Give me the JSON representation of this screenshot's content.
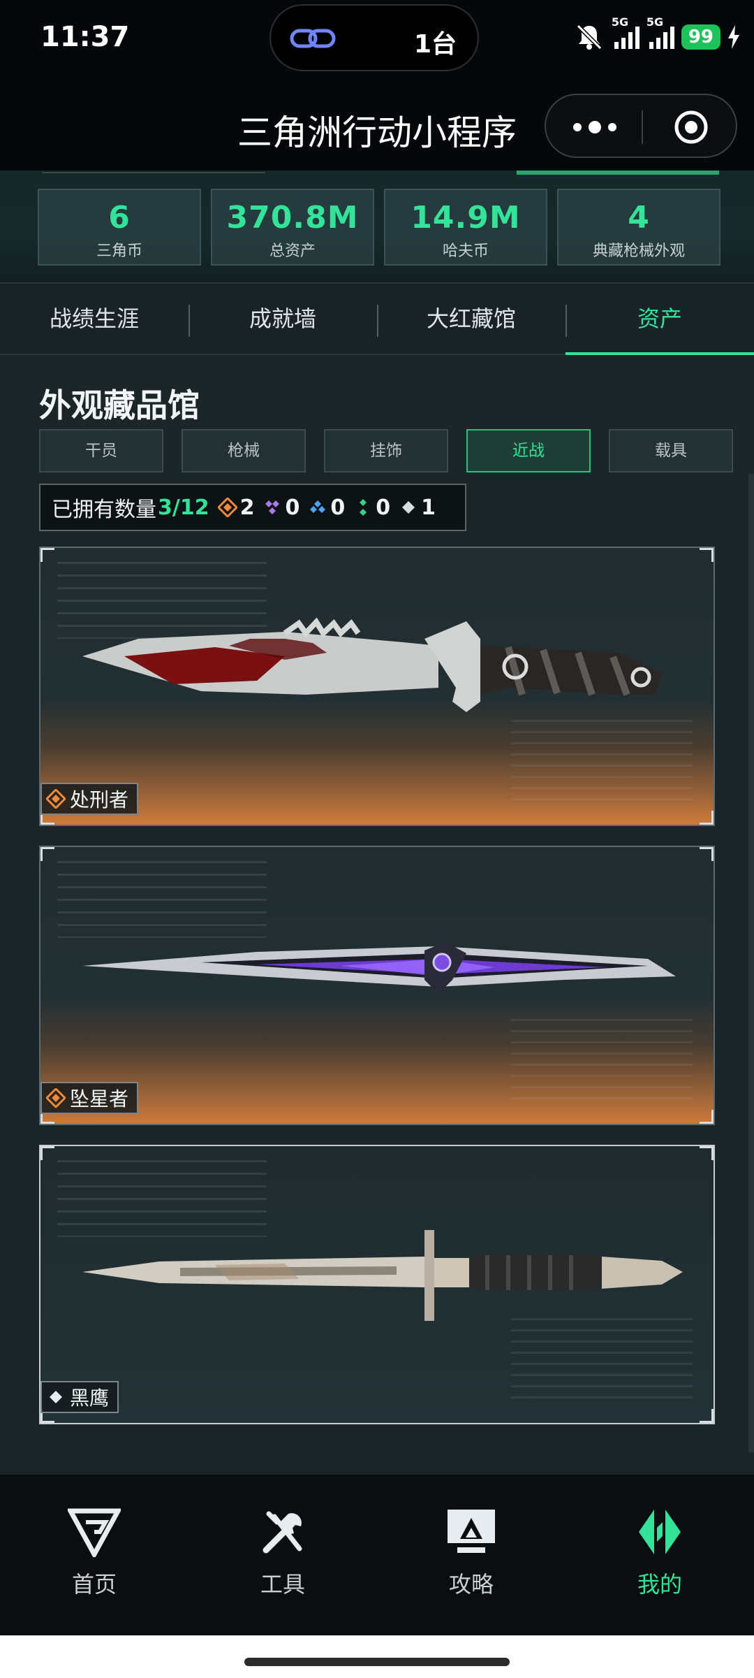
{
  "status_bar": {
    "time": "11:37",
    "island_text": "1台",
    "signal1": "5G",
    "signal2": "5G",
    "battery": "99"
  },
  "header": {
    "title": "三角洲行动小程序"
  },
  "stats": [
    {
      "value": "6",
      "label": "三角币"
    },
    {
      "value": "370.8M",
      "label": "总资产"
    },
    {
      "value": "14.9M",
      "label": "哈夫币"
    },
    {
      "value": "4",
      "label": "典藏枪械外观"
    }
  ],
  "tabs": [
    {
      "label": "战绩生涯",
      "active": false
    },
    {
      "label": "成就墙",
      "active": false
    },
    {
      "label": "大红藏馆",
      "active": false
    },
    {
      "label": "资产",
      "active": true
    }
  ],
  "section": {
    "title": "外观藏品馆"
  },
  "filters": [
    {
      "label": "干员",
      "active": false
    },
    {
      "label": "枪械",
      "active": false
    },
    {
      "label": "挂饰",
      "active": false
    },
    {
      "label": "近战",
      "active": true
    },
    {
      "label": "载具",
      "active": false
    }
  ],
  "owned": {
    "label": "已拥有数量",
    "count": "3/12",
    "tiers": [
      {
        "color": "#f08a3a",
        "count": "2"
      },
      {
        "color": "#a877e8",
        "count": "0"
      },
      {
        "color": "#4aa3ff",
        "count": "0"
      },
      {
        "color": "#33d48a",
        "count": "0"
      },
      {
        "color": "#d8dde0",
        "count": "1"
      }
    ]
  },
  "items": [
    {
      "name": "处刑者",
      "rarity_color": "#f08a3a",
      "icon": "executioner-knife"
    },
    {
      "name": "坠星者",
      "rarity_color": "#f08a3a",
      "icon": "starfall-dagger"
    },
    {
      "name": "黑鹰",
      "rarity_color": "#e6ecef",
      "icon": "blackhawk-bayonet"
    }
  ],
  "bottom_nav": [
    {
      "label": "首页",
      "icon": "home-logo-icon",
      "active": false
    },
    {
      "label": "工具",
      "icon": "tools-icon",
      "active": false
    },
    {
      "label": "攻略",
      "icon": "guide-icon",
      "active": false
    },
    {
      "label": "我的",
      "icon": "profile-logo-icon",
      "active": true
    }
  ],
  "colors": {
    "accent": "#33e39a",
    "background": "#1c2629",
    "legendary": "#f08a3a"
  }
}
